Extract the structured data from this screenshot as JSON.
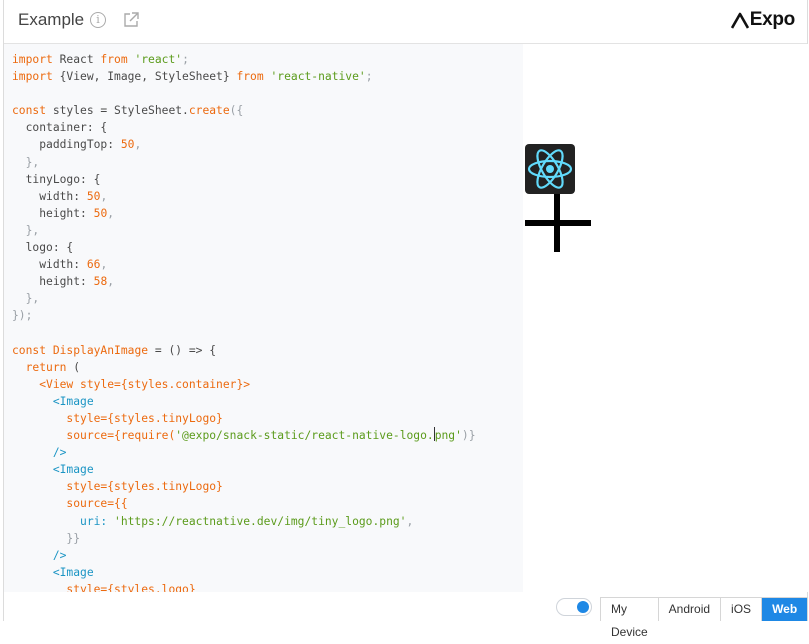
{
  "header": {
    "title": "Example",
    "brand": "Expo",
    "info_glyph": "i"
  },
  "editor": {
    "line1_kw": "import",
    "line1_rest": " React ",
    "line1_from": "from",
    "line1_str": "'react'",
    "line1_end": ";",
    "line2_kw": "import",
    "line2_rest": " {View, Image, StyleSheet} ",
    "line2_from": "from",
    "line2_str": "'react-native'",
    "line2_end": ";",
    "styles_const": "const",
    "styles_decl": " styles = StyleSheet.",
    "styles_create": "create",
    "styles_open": "({",
    "container_key": "container: {",
    "paddingTop_key": "paddingTop: ",
    "paddingTop_val": "50",
    "tinyLogo_key": "tinyLogo: {",
    "width_key": "width: ",
    "tiny_width": "50",
    "height_key": "height: ",
    "tiny_height": "50",
    "logo_key": "logo: {",
    "logo_width": "66",
    "logo_height": "58",
    "close_styles": "});",
    "comp_const": "const",
    "comp_name": "DisplayAnImage",
    "comp_sig": " = () => {",
    "return_kw": "return",
    "return_paren": " (",
    "view_open": "<View",
    "view_style": " style={styles.container}>",
    "image_tag": "<Image",
    "style_tiny": "style={styles.tinyLogo}",
    "source_require": "source={require(",
    "require_path_a": "'@expo/snack-static/react-native-logo.",
    "require_path_b": "png'",
    "require_close": ")}",
    "self_close": "/>",
    "source_open": "source={{",
    "uri_key": "uri: ",
    "uri_val": "'https://reactnative.dev/img/tiny_logo.png'",
    "uri_comma": ",",
    "source_close": "}}",
    "style_logo": "style={styles.logo}"
  },
  "footer": {
    "tabs": [
      "My Device",
      "Android",
      "iOS",
      "Web"
    ],
    "active_tab": "Web"
  },
  "colors": {
    "accent": "#1e88e5",
    "keyword": "#ec6a0f",
    "string": "#5b9b1b",
    "jsx_tag": "#1b95c4",
    "editor_bg": "#f8f9fb"
  },
  "icons": {
    "info": "info-icon",
    "open": "open-in-new-icon",
    "brand": "expo-logo-icon",
    "react": "react-logo-icon",
    "toggle": "toggle-switch"
  }
}
